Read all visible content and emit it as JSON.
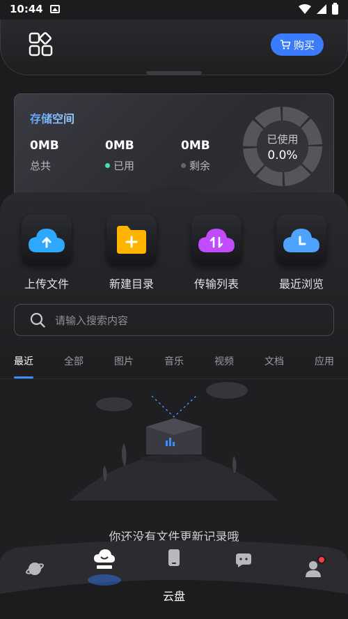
{
  "status_bar": {
    "time": "10:44"
  },
  "header": {
    "buy_label": "购买"
  },
  "storage": {
    "title": "存储空间",
    "total_value": "0MB",
    "total_label": "总共",
    "used_value": "0MB",
    "used_label": "已用",
    "free_value": "0MB",
    "free_label": "剩余",
    "gauge_label": "已使用",
    "gauge_value": "0.0%"
  },
  "actions": [
    {
      "label": "上传文件",
      "icon": "upload-cloud-icon",
      "color": "#2ea8ff"
    },
    {
      "label": "新建目录",
      "icon": "new-folder-icon",
      "color": "#ffb400"
    },
    {
      "label": "传输列表",
      "icon": "transfer-cloud-icon",
      "color": "#c04bff"
    },
    {
      "label": "最近浏览",
      "icon": "recent-cloud-icon",
      "color": "#4da3ff"
    }
  ],
  "search": {
    "placeholder": "请输入搜索内容"
  },
  "tabs": [
    "最近",
    "全部",
    "图片",
    "音乐",
    "视频",
    "文档",
    "应用"
  ],
  "empty_message": "你还没有文件更新记录哦",
  "bottom_nav": {
    "active_label": "云盘",
    "items": [
      "planet-icon",
      "cloud-disk-icon",
      "phone-icon",
      "chat-icon",
      "profile-icon"
    ]
  }
}
